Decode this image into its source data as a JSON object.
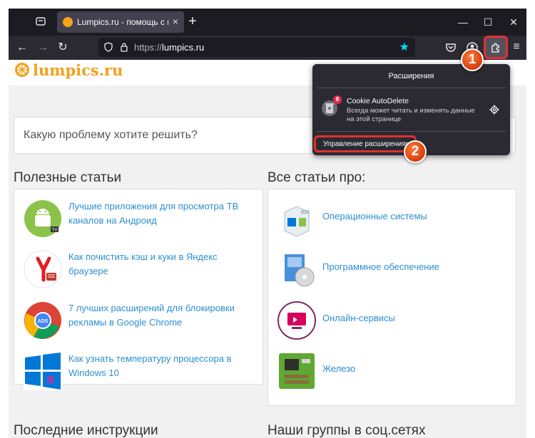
{
  "browser": {
    "tab": {
      "title": "Lumpics.ru - помощь с компьют",
      "close_glyph": "×"
    },
    "new_tab_glyph": "+",
    "window_controls": {
      "minimize": "—",
      "maximize": "☐",
      "close": "✕"
    },
    "url": {
      "protocol": "https://",
      "host": "lumpics.ru"
    },
    "colors": {
      "accent_red": "#e0302f",
      "badge_orange": "#ef5b1f",
      "link_blue": "#2d8fce",
      "logo_orange": "#f2a11b"
    }
  },
  "site": {
    "logo_text": "lumpics.ru",
    "search_placeholder": "Какую проблему хотите решить?",
    "useful_title": "Полезные статьи",
    "all_title": "Все статьи про:",
    "latest_title": "Последние инструкции",
    "groups_title": "Наши группы в соц.сетях",
    "articles": [
      {
        "icon": "android-tv-icon",
        "text": "Лучшие приложения для просмотра ТВ каналов на Андроид"
      },
      {
        "icon": "yandex-browser-icon",
        "text": "Как почистить кэш и куки в Яндекс браузере"
      },
      {
        "icon": "chrome-adblock-icon",
        "text": "7 лучших расширений для блокировки рекламы в Google Chrome"
      },
      {
        "icon": "windows-10-icon",
        "text": "Как узнать температуру процессора в Windows 10"
      }
    ],
    "categories": [
      {
        "icon": "os-icon",
        "text": "Операционные системы"
      },
      {
        "icon": "software-icon",
        "text": "Программное обеспечение"
      },
      {
        "icon": "online-services-icon",
        "text": "Онлайн-сервисы"
      },
      {
        "icon": "hardware-icon",
        "text": "Железо"
      }
    ]
  },
  "extensions_popup": {
    "title": "Расширения",
    "extension": {
      "name": "Cookie AutoDelete",
      "badge": "8",
      "description": "Всегда может читать и изменять данные на этой странице"
    },
    "manage_label": "Управление расширениями"
  },
  "steps": {
    "one": "1",
    "two": "2"
  }
}
